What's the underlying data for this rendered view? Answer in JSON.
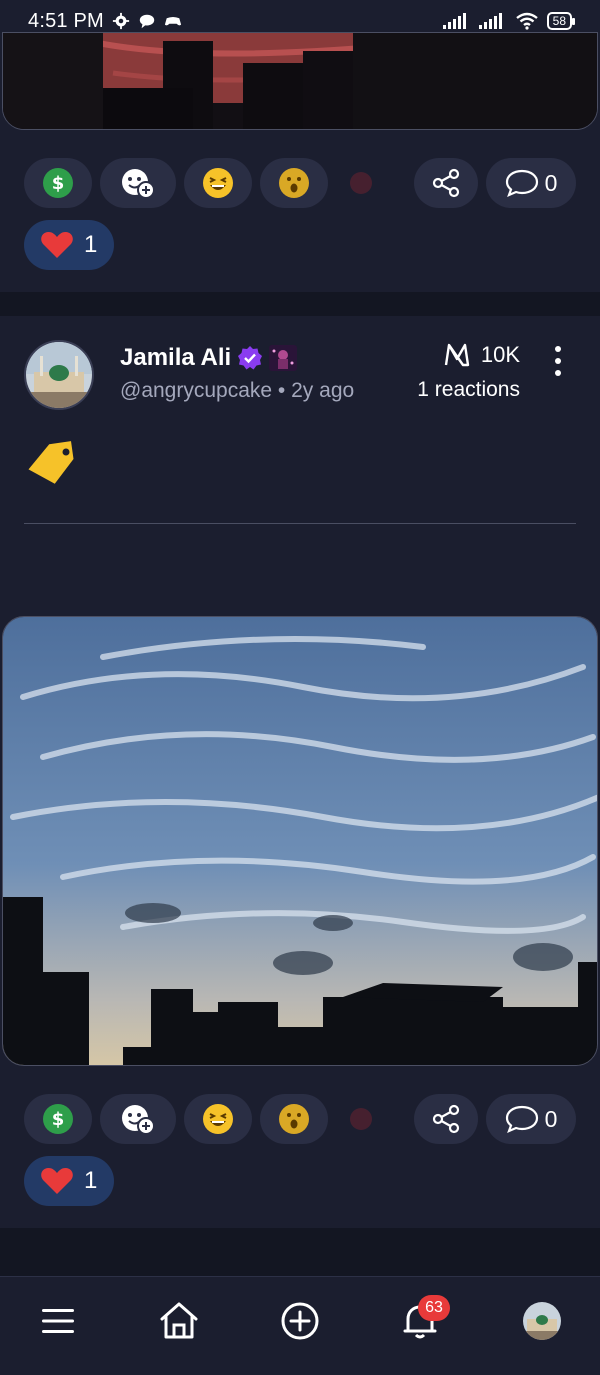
{
  "status_bar": {
    "time": "4:51 PM",
    "battery": "58",
    "icons": [
      "settings-gear-icon",
      "chat-bubble-icon",
      "gamepad-icon",
      "signal-icon",
      "signal-icon",
      "wifi-icon",
      "battery-icon"
    ]
  },
  "colors": {
    "background": "#151826",
    "card": "#1b1e2f",
    "pill": "#2a2e44",
    "heart_pill": "#233a66",
    "verified": "#8a3cf0",
    "badge": "#e83a3a",
    "tag": "#f6c229"
  },
  "top_post": {
    "comments_count": "0",
    "heart_count": "1"
  },
  "main_post": {
    "author_name": "Jamila Ali",
    "author_handle": "@angrycupcake",
    "separator": "•",
    "time_ago": "2y ago",
    "views": "10K",
    "reactions": "1 reactions",
    "comments_count": "0",
    "heart_count": "1"
  },
  "bottom_nav": {
    "notifications_badge": "63",
    "items": [
      "menu-icon",
      "home-icon",
      "create-post-icon",
      "notifications-icon",
      "profile-avatar"
    ]
  }
}
